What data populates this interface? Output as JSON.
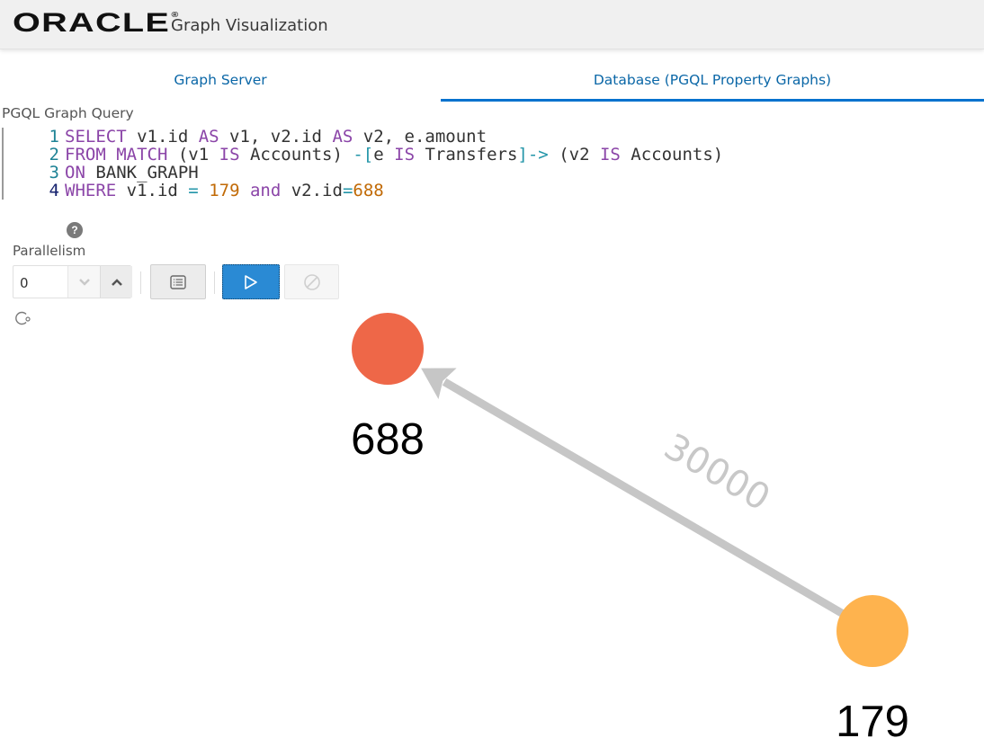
{
  "header": {
    "logo": "ORACLE",
    "logo_mark": "®",
    "app_title": "Graph Visualization"
  },
  "tabs": [
    {
      "label": "Graph Server",
      "active": false
    },
    {
      "label": "Database (PGQL Property Graphs)",
      "active": true
    }
  ],
  "query": {
    "label": "PGQL Graph Query",
    "lines": [
      {
        "number": "1",
        "tokens": [
          {
            "t": "SELECT",
            "c": "kw"
          },
          {
            "t": " v1.id ",
            "c": ""
          },
          {
            "t": "AS",
            "c": "kw"
          },
          {
            "t": " v1, v2.id ",
            "c": ""
          },
          {
            "t": "AS",
            "c": "kw"
          },
          {
            "t": " v2, e.amount",
            "c": ""
          }
        ]
      },
      {
        "number": "2",
        "tokens": [
          {
            "t": "FROM",
            "c": "kw"
          },
          {
            "t": " ",
            "c": ""
          },
          {
            "t": "MATCH",
            "c": "kw"
          },
          {
            "t": " (v1 ",
            "c": ""
          },
          {
            "t": "IS",
            "c": "kw"
          },
          {
            "t": " Accounts) ",
            "c": ""
          },
          {
            "t": "-[",
            "c": "op"
          },
          {
            "t": "e ",
            "c": ""
          },
          {
            "t": "IS",
            "c": "kw"
          },
          {
            "t": " Transfers",
            "c": ""
          },
          {
            "t": "]->",
            "c": "op"
          },
          {
            "t": " (v2 ",
            "c": ""
          },
          {
            "t": "IS",
            "c": "kw"
          },
          {
            "t": " Accounts)",
            "c": ""
          }
        ]
      },
      {
        "number": "3",
        "tokens": [
          {
            "t": "ON",
            "c": "kw"
          },
          {
            "t": " BANK_GRAPH",
            "c": ""
          }
        ]
      },
      {
        "number": "4",
        "active": true,
        "tokens": [
          {
            "t": "WHERE",
            "c": "kw"
          },
          {
            "t": " v1.id ",
            "c": ""
          },
          {
            "t": "=",
            "c": "op"
          },
          {
            "t": " ",
            "c": ""
          },
          {
            "t": "179",
            "c": "num"
          },
          {
            "t": " ",
            "c": ""
          },
          {
            "t": "and",
            "c": "kw"
          },
          {
            "t": " v2.id",
            "c": ""
          },
          {
            "t": "=",
            "c": "op"
          },
          {
            "t": "688",
            "c": "num"
          }
        ]
      }
    ]
  },
  "controls": {
    "help_icon": "question-circle-icon",
    "parallelism_label": "Parallelism",
    "parallelism_value": "0",
    "decrement_icon": "chevron-down-icon",
    "increment_icon": "chevron-up-icon",
    "list_button_icon": "list-icon",
    "run_button_icon": "play-icon",
    "cancel_button_icon": "cancel-icon",
    "status_icon": "spinner-icon"
  },
  "graph": {
    "edge_color": "#c6c6c6",
    "nodes": [
      {
        "id": "688",
        "label": "688",
        "color": "#ee6748"
      },
      {
        "id": "179",
        "label": "179",
        "color": "#feb34e"
      }
    ],
    "edges": [
      {
        "source": "179",
        "target": "688",
        "label": "30000"
      }
    ]
  }
}
